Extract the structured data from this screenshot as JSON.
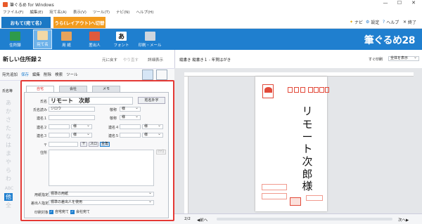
{
  "window": {
    "title": "筆ぐるめ for Windows",
    "controls": [
      "—",
      "☐",
      "✕"
    ]
  },
  "menu": [
    "ファイル(F)",
    "編集(E)",
    "宛て名(A)",
    "表示(V)",
    "ツール(T)",
    "ナビ(N)",
    "ヘルプ(H)"
  ],
  "modes": {
    "front": "おもて(宛て名)",
    "back": "うら(レイアウト)へ切替"
  },
  "topright": {
    "navi": "ナビ",
    "settings": "設定",
    "help": "ヘルプ",
    "exit": "終了"
  },
  "ribbon": [
    {
      "label": "住所録"
    },
    {
      "label": "宛て名"
    },
    {
      "label": "用 紙"
    },
    {
      "label": "差出人"
    },
    {
      "label": "フォント"
    },
    {
      "label": "印刷・メール"
    }
  ],
  "brand": "筆ぐるめ28",
  "left": {
    "title": "新しい住所録２",
    "undo": "元に戻す",
    "redo": "やり直す",
    "detail": "詳細表示",
    "toolbar": [
      "宛先追加",
      "保存",
      "編集",
      "削除",
      "検索",
      "ツール"
    ],
    "sortlabel": "氏名等"
  },
  "index": [
    "あ",
    "か",
    "さ",
    "た",
    "な",
    "は",
    "ま",
    "や",
    "ら",
    "わ",
    "ABC",
    "他",
    "全"
  ],
  "dialog": {
    "tabs": [
      "自宅",
      "会社",
      "メモ"
    ],
    "name_label": "氏名",
    "name_value": "リモート　次郎",
    "gaiji_btn": "姓名外字",
    "reading_label": "氏名読み",
    "reading_value": "ジロウ",
    "rel1": "連名１",
    "rel2": "連名２",
    "rel3": "連名３",
    "rel4": "連名４",
    "rel5": "連名５",
    "title_label": "敬称",
    "title_value": "様",
    "suffix": "様",
    "zip_label": "〒",
    "addr_label": "住所",
    "addr_btn": "旧住",
    "btn_t": "〒",
    "btn_s": "スロ",
    "btn_k": "全角",
    "appoint_label": "用紙指定",
    "appoint_value": "標準の用紙",
    "sender_label": "差出人指定",
    "sender_value": "標準の差出人を使用",
    "print_label": "印刷対象",
    "print_home": "自宅宛て",
    "print_office": "会社宛て"
  },
  "right": {
    "header": "縦書き 縦書き１ - 年賀はがき",
    "print_size": "すぐ印刷",
    "fit": "全体を表示",
    "address_lines": [
      "リ",
      "モ",
      "ー",
      "ト",
      "次",
      "郎",
      "様"
    ],
    "page": "2/2",
    "prev": "◀前へ",
    "next": "次へ▶"
  },
  "colors": {
    "ribbon": "#1f7fcf",
    "accent": "#f29b1e",
    "highlight": "#e53935"
  }
}
